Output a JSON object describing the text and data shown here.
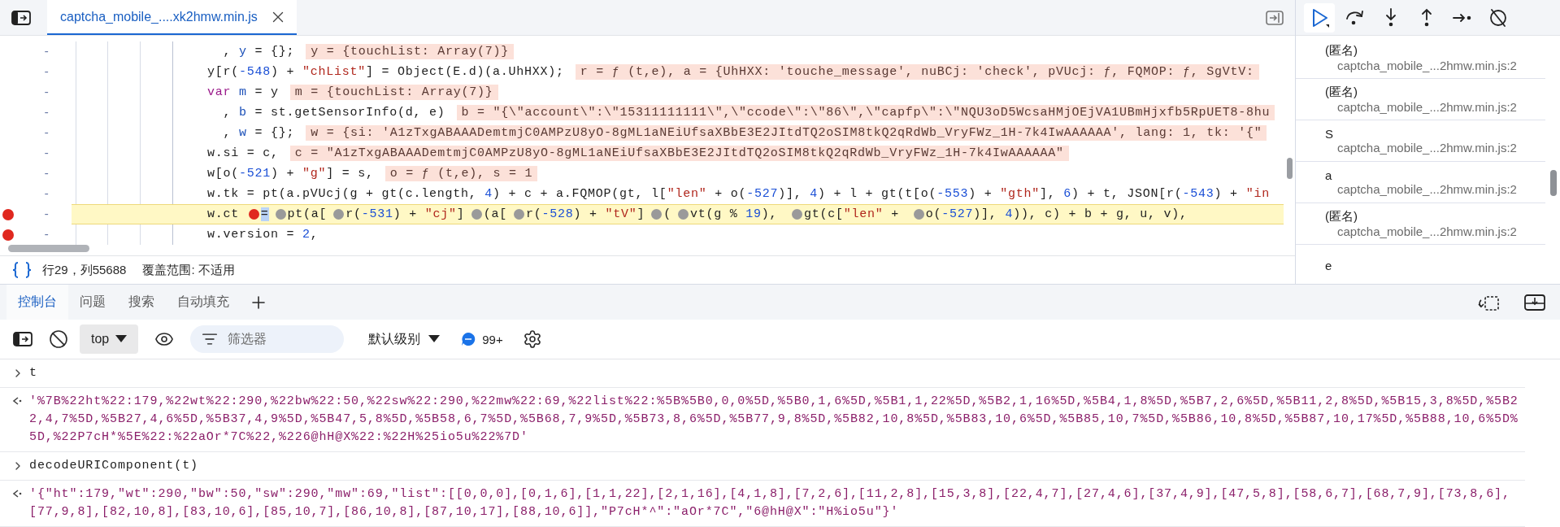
{
  "tab_bar": {
    "tabs": [
      {
        "label": "captcha_mobile_....xk2hmw.min.js",
        "selected": true
      }
    ]
  },
  "editor": {
    "lines": [
      {
        "number": "-",
        "breakpoint": false,
        "current": false,
        "segments": [
          {
            "text": "  , ",
            "kind": "plain"
          },
          {
            "text": "y",
            "kind": "def"
          },
          {
            "text": " = {};",
            "kind": "plain"
          }
        ],
        "inline_value": "y = {touchList: Array(7)}"
      },
      {
        "number": "-",
        "breakpoint": false,
        "current": false,
        "segments": [
          {
            "text": "y[r(",
            "kind": "plain"
          },
          {
            "text": "-548",
            "kind": "number"
          },
          {
            "text": ") + ",
            "kind": "plain"
          },
          {
            "text": "\"chList\"",
            "kind": "string"
          },
          {
            "text": "] = Object(E.d)(a.UhHXX);",
            "kind": "plain"
          }
        ],
        "inline_value": "r = ƒ (t,e), a = {UhHXX: 'touche_message', nuBCj: 'check', pVUcj: ƒ, FQMOP: ƒ, SgVtV:"
      },
      {
        "number": "-",
        "breakpoint": false,
        "current": false,
        "segments": [
          {
            "text": "var",
            "kind": "keyword"
          },
          {
            "text": " m",
            "kind": "def"
          },
          {
            "text": " = y",
            "kind": "plain"
          }
        ],
        "inline_value": "m = {touchList: Array(7)}"
      },
      {
        "number": "-",
        "breakpoint": false,
        "current": false,
        "segments": [
          {
            "text": "  , ",
            "kind": "plain"
          },
          {
            "text": "b",
            "kind": "def"
          },
          {
            "text": " = st.getSensorInfo(d, e)",
            "kind": "plain"
          }
        ],
        "inline_value": "b = \"{\\\"account\\\":\\\"15311111111\\\",\\\"ccode\\\":\\\"86\\\",\\\"capfp\\\":\\\"NQU3oD5WcsaHMjOEjVA1UBmHjxfb5RpUET8-8hu"
      },
      {
        "number": "-",
        "breakpoint": false,
        "current": false,
        "segments": [
          {
            "text": "  , ",
            "kind": "plain"
          },
          {
            "text": "w",
            "kind": "def"
          },
          {
            "text": " = {};",
            "kind": "plain"
          }
        ],
        "inline_value": "w = {si: 'A1zTxgABAAADemtmjC0AMPzU8yO-8gML1aNEiUfsaXBbE3E2JItdTQ2oSIM8tkQ2qRdWb_VryFWz_1H-7k4IwAAAAAA', lang: 1, tk: '{\""
      },
      {
        "number": "-",
        "breakpoint": false,
        "current": false,
        "segments": [
          {
            "text": "w.si = c,",
            "kind": "plain"
          }
        ],
        "inline_value": "c = \"A1zTxgABAAADemtmjC0AMPzU8yO-8gML1aNEiUfsaXBbE3E2JItdTQ2oSIM8tkQ2qRdWb_VryFWz_1H-7k4IwAAAAAA\""
      },
      {
        "number": "-",
        "breakpoint": false,
        "current": false,
        "segments": [
          {
            "text": "w[o(",
            "kind": "plain"
          },
          {
            "text": "-521",
            "kind": "number"
          },
          {
            "text": ") + ",
            "kind": "plain"
          },
          {
            "text": "\"g\"",
            "kind": "string"
          },
          {
            "text": "] = s,",
            "kind": "plain"
          }
        ],
        "inline_value": "o = ƒ (t,e), s = 1"
      },
      {
        "number": "-",
        "breakpoint": false,
        "current": false,
        "segments": [
          {
            "text": "w.tk = pt(a.pVUcj(g + gt(c.length, ",
            "kind": "plain"
          },
          {
            "text": "4",
            "kind": "number"
          },
          {
            "text": ") + c + a.FQMOP(gt, l[",
            "kind": "plain"
          },
          {
            "text": "\"len\"",
            "kind": "string"
          },
          {
            "text": " + o(",
            "kind": "plain"
          },
          {
            "text": "-527",
            "kind": "number"
          },
          {
            "text": ")], ",
            "kind": "plain"
          },
          {
            "text": "4",
            "kind": "number"
          },
          {
            "text": ") + l + gt(t[o(",
            "kind": "plain"
          },
          {
            "text": "-553",
            "kind": "number"
          },
          {
            "text": ") + ",
            "kind": "plain"
          },
          {
            "text": "\"gth\"",
            "kind": "string"
          },
          {
            "text": "], ",
            "kind": "plain"
          },
          {
            "text": "6",
            "kind": "number"
          },
          {
            "text": ") + t, JSON[r(",
            "kind": "plain"
          },
          {
            "text": "-543",
            "kind": "number"
          },
          {
            "text": ") + ",
            "kind": "plain"
          },
          {
            "text": "\"in",
            "kind": "string"
          }
        ]
      },
      {
        "number": "-",
        "breakpoint": true,
        "current": true,
        "segments": [
          {
            "text": "w.ct ",
            "kind": "plain"
          },
          {
            "kind": "marker",
            "on": true
          },
          {
            "text": "=",
            "kind": "selection"
          },
          {
            "kind": "marker",
            "on": false
          },
          {
            "text": "pt(a[",
            "kind": "plain"
          },
          {
            "kind": "marker",
            "on": false
          },
          {
            "text": "r(",
            "kind": "plain"
          },
          {
            "text": "-531",
            "kind": "number"
          },
          {
            "text": ") + ",
            "kind": "plain"
          },
          {
            "text": "\"cj\"",
            "kind": "string"
          },
          {
            "text": "]",
            "kind": "plain"
          },
          {
            "kind": "marker",
            "on": false
          },
          {
            "text": "(a[",
            "kind": "plain"
          },
          {
            "kind": "marker",
            "on": false
          },
          {
            "text": "r(",
            "kind": "plain"
          },
          {
            "text": "-528",
            "kind": "number"
          },
          {
            "text": ") + ",
            "kind": "plain"
          },
          {
            "text": "\"tV\"",
            "kind": "string"
          },
          {
            "text": "]",
            "kind": "plain"
          },
          {
            "kind": "marker",
            "on": false
          },
          {
            "text": "(",
            "kind": "plain"
          },
          {
            "kind": "marker",
            "on": false
          },
          {
            "text": "vt(g % ",
            "kind": "plain"
          },
          {
            "text": "19",
            "kind": "number"
          },
          {
            "text": "), ",
            "kind": "plain"
          },
          {
            "kind": "marker",
            "on": false
          },
          {
            "text": "gt(c[",
            "kind": "plain"
          },
          {
            "text": "\"len\"",
            "kind": "string"
          },
          {
            "text": " + ",
            "kind": "plain"
          },
          {
            "kind": "marker",
            "on": false
          },
          {
            "text": "o(",
            "kind": "plain"
          },
          {
            "text": "-527",
            "kind": "number"
          },
          {
            "text": ")], ",
            "kind": "plain"
          },
          {
            "text": "4",
            "kind": "number"
          },
          {
            "text": ")), c) + b + g, u, v),",
            "kind": "plain"
          }
        ]
      },
      {
        "number": "-",
        "breakpoint": true,
        "current": false,
        "segments": [
          {
            "text": "w.version = ",
            "kind": "plain"
          },
          {
            "text": "2",
            "kind": "number"
          },
          {
            "text": ",",
            "kind": "plain"
          }
        ]
      }
    ]
  },
  "status_bar": {
    "position": "行29，列55688",
    "coverage": "覆盖范围: 不适用"
  },
  "debugger_toolbar": {
    "buttons": [
      {
        "kind": "resume",
        "selected": true
      },
      {
        "kind": "step-over",
        "selected": false
      },
      {
        "kind": "step-into",
        "selected": false
      },
      {
        "kind": "step-out",
        "selected": false
      },
      {
        "kind": "step",
        "selected": false
      },
      {
        "kind": "deactivate",
        "selected": false
      }
    ]
  },
  "call_stack": [
    {
      "name": "(匿名)",
      "location": "captcha_mobile_...2hmw.min.js:2"
    },
    {
      "name": "(匿名)",
      "location": "captcha_mobile_...2hmw.min.js:2"
    },
    {
      "name": "S",
      "location": "captcha_mobile_...2hmw.min.js:2"
    },
    {
      "name": "a",
      "location": "captcha_mobile_...2hmw.min.js:2"
    },
    {
      "name": "(匿名)",
      "location": "captcha_mobile_...2hmw.min.js:2"
    },
    {
      "name": "e"
    }
  ],
  "drawer_tabs": [
    {
      "label": "控制台",
      "selected": true
    },
    {
      "label": "问题",
      "selected": false
    },
    {
      "label": "搜索",
      "selected": false
    },
    {
      "label": "自动填充",
      "selected": false
    }
  ],
  "console_toolbar": {
    "context": "top",
    "filter_placeholder": "筛选器",
    "level": "默认级别",
    "message_count": "99+"
  },
  "console": [
    {
      "kind": "input",
      "text": "t"
    },
    {
      "kind": "output",
      "text": "'%7B%22ht%22:179,%22wt%22:290,%22bw%22:50,%22sw%22:290,%22mw%22:69,%22list%22:%5B%5B0,0,0%5D,%5B0,1,6%5D,%5B1,1,22%5D,%5B2,1,16%5D,%5B4,1,8%5D,%5B7,2,6%5D,%5B11,2,8%5D,%5B15,3,8%5D,%5B22,4,7%5D,%5B27,4,6%5D,%5B37,4,9%5D,%5B47,5,8%5D,%5B58,6,7%5D,%5B68,7,9%5D,%5B73,8,6%5D,%5B77,9,8%5D,%5B82,10,8%5D,%5B83,10,6%5D,%5B85,10,7%5D,%5B86,10,8%5D,%5B87,10,17%5D,%5B88,10,6%5D%5D,%22P7cH*%5E%22:%22aOr*7C%22,%226@hH@X%22:%22H%25io5u%22%7D'"
    },
    {
      "kind": "input",
      "text": "decodeURIComponent(t)"
    },
    {
      "kind": "output",
      "text": "'{\"ht\":179,\"wt\":290,\"bw\":50,\"sw\":290,\"mw\":69,\"list\":[[0,0,0],[0,1,6],[1,1,22],[2,1,16],[4,1,8],[7,2,6],[11,2,8],[15,3,8],[22,4,7],[27,4,6],[37,4,9],[47,5,8],[58,6,7],[68,7,9],[73,8,6],[77,9,8],[82,10,8],[83,10,6],[85,10,7],[86,10,8],[87,10,17],[88,10,6]],\"P7cH*^\":\"aOr*7C\",\"6@hH@X\":\"H%io5u\"}'"
    }
  ]
}
